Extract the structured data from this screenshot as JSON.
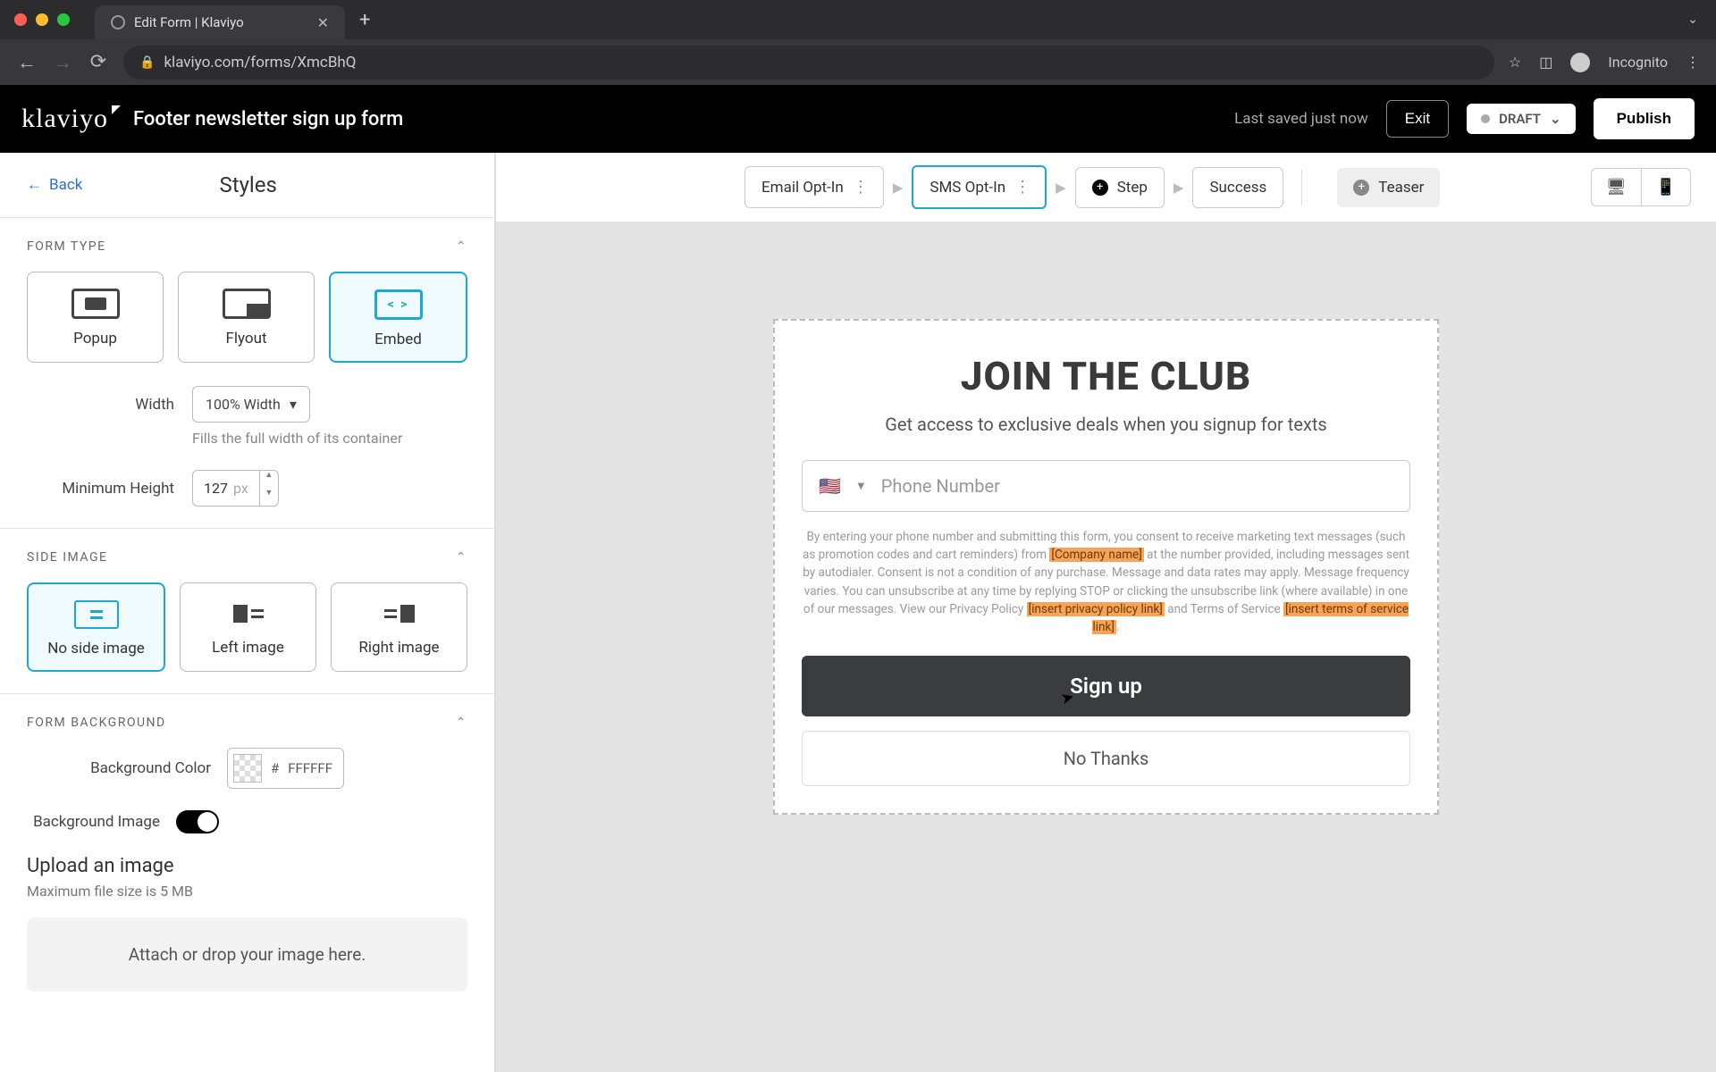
{
  "browser": {
    "tab_title": "Edit Form | Klaviyo",
    "url": "klaviyo.com/forms/XmcBhQ",
    "incognito_label": "Incognito"
  },
  "header": {
    "logo": "klaviyo",
    "form_name": "Footer newsletter sign up form",
    "last_saved": "Last saved just now",
    "exit": "Exit",
    "status": "DRAFT",
    "publish": "Publish"
  },
  "sidebar": {
    "back": "Back",
    "title": "Styles",
    "form_type": {
      "heading": "Form Type",
      "options": {
        "popup": "Popup",
        "flyout": "Flyout",
        "embed": "Embed"
      },
      "selected": "embed",
      "width_label": "Width",
      "width_value": "100% Width",
      "width_help": "Fills the full width of its container",
      "min_height_label": "Minimum Height",
      "min_height_value": "127",
      "min_height_unit": "px"
    },
    "side_image": {
      "heading": "Side Image",
      "options": {
        "none": "No side image",
        "left": "Left image",
        "right": "Right image"
      },
      "selected": "none"
    },
    "background": {
      "heading": "Form Background",
      "color_label": "Background Color",
      "color_prefix": "#",
      "color_value": "FFFFFF",
      "image_label": "Background Image",
      "upload_title": "Upload an image",
      "upload_sub": "Maximum file size is 5 MB",
      "dropzone": "Attach or drop your image here."
    }
  },
  "steps": {
    "email": "Email Opt-In",
    "sms": "SMS Opt-In",
    "add_step": "Step",
    "success": "Success",
    "teaser": "Teaser"
  },
  "preview": {
    "heading": "JOIN THE CLUB",
    "subheading": "Get access to exclusive deals when you signup for texts",
    "flag": "🇺🇸",
    "phone_placeholder": "Phone Number",
    "disclaimer_1": "By entering your phone number and submitting this form, you consent to receive marketing text messages (such as promotion codes and cart reminders) from ",
    "company_token": "[Company name]",
    "disclaimer_2": " at the number provided, including messages sent by autodialer. Consent is not a condition of any purchase. Message and data rates may apply. Message frequency varies. You can unsubscribe at any time by replying STOP or clicking the unsubscribe link (where available) in one of our messages. View our Privacy Policy ",
    "privacy_token": "[insert privacy policy link]",
    "disclaimer_3": " and Terms of Service ",
    "tos_token": "[insert terms of service link]",
    "disclaimer_4": ".",
    "signup": "Sign up",
    "nothanks": "No Thanks"
  }
}
